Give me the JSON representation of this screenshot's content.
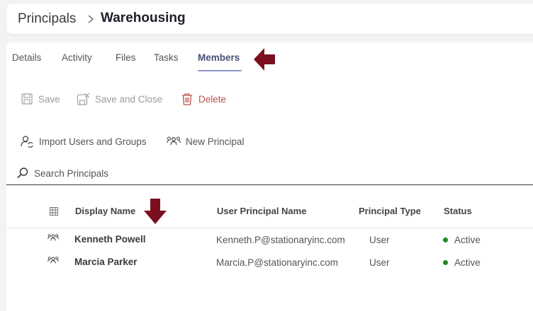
{
  "breadcrumb": {
    "root": "Principals",
    "current": "Warehousing"
  },
  "tabs": [
    {
      "label": "Details"
    },
    {
      "label": "Activity"
    },
    {
      "label": "Files"
    },
    {
      "label": "Tasks"
    },
    {
      "label": "Members",
      "active": true
    }
  ],
  "toolbar": {
    "save": "Save",
    "save_and_close": "Save and Close",
    "delete": "Delete"
  },
  "actions": {
    "import": "Import Users and Groups",
    "new_principal": "New Principal"
  },
  "search": {
    "label": "Search Principals"
  },
  "table": {
    "columns": [
      "Display Name",
      "User Principal Name",
      "Principal Type",
      "Status"
    ],
    "rows": [
      {
        "display_name": "Kenneth Powell",
        "upn": "Kenneth.P@stationaryinc.com",
        "type": "User",
        "status": "Active"
      },
      {
        "display_name": "Marcia Parker",
        "upn": "Marcia.P@stationaryinc.com",
        "type": "User",
        "status": "Active"
      }
    ]
  },
  "colors": {
    "accent": "#8f95c9",
    "annotation_arrow": "#7a0f1f",
    "status_active": "#1f8a1f",
    "danger": "#b9534d"
  },
  "icons": [
    "chevron-right-icon",
    "save-icon",
    "save-close-icon",
    "trash-icon",
    "import-users-icon",
    "new-principal-icon",
    "search-icon",
    "grid-icon",
    "principal-icon"
  ]
}
